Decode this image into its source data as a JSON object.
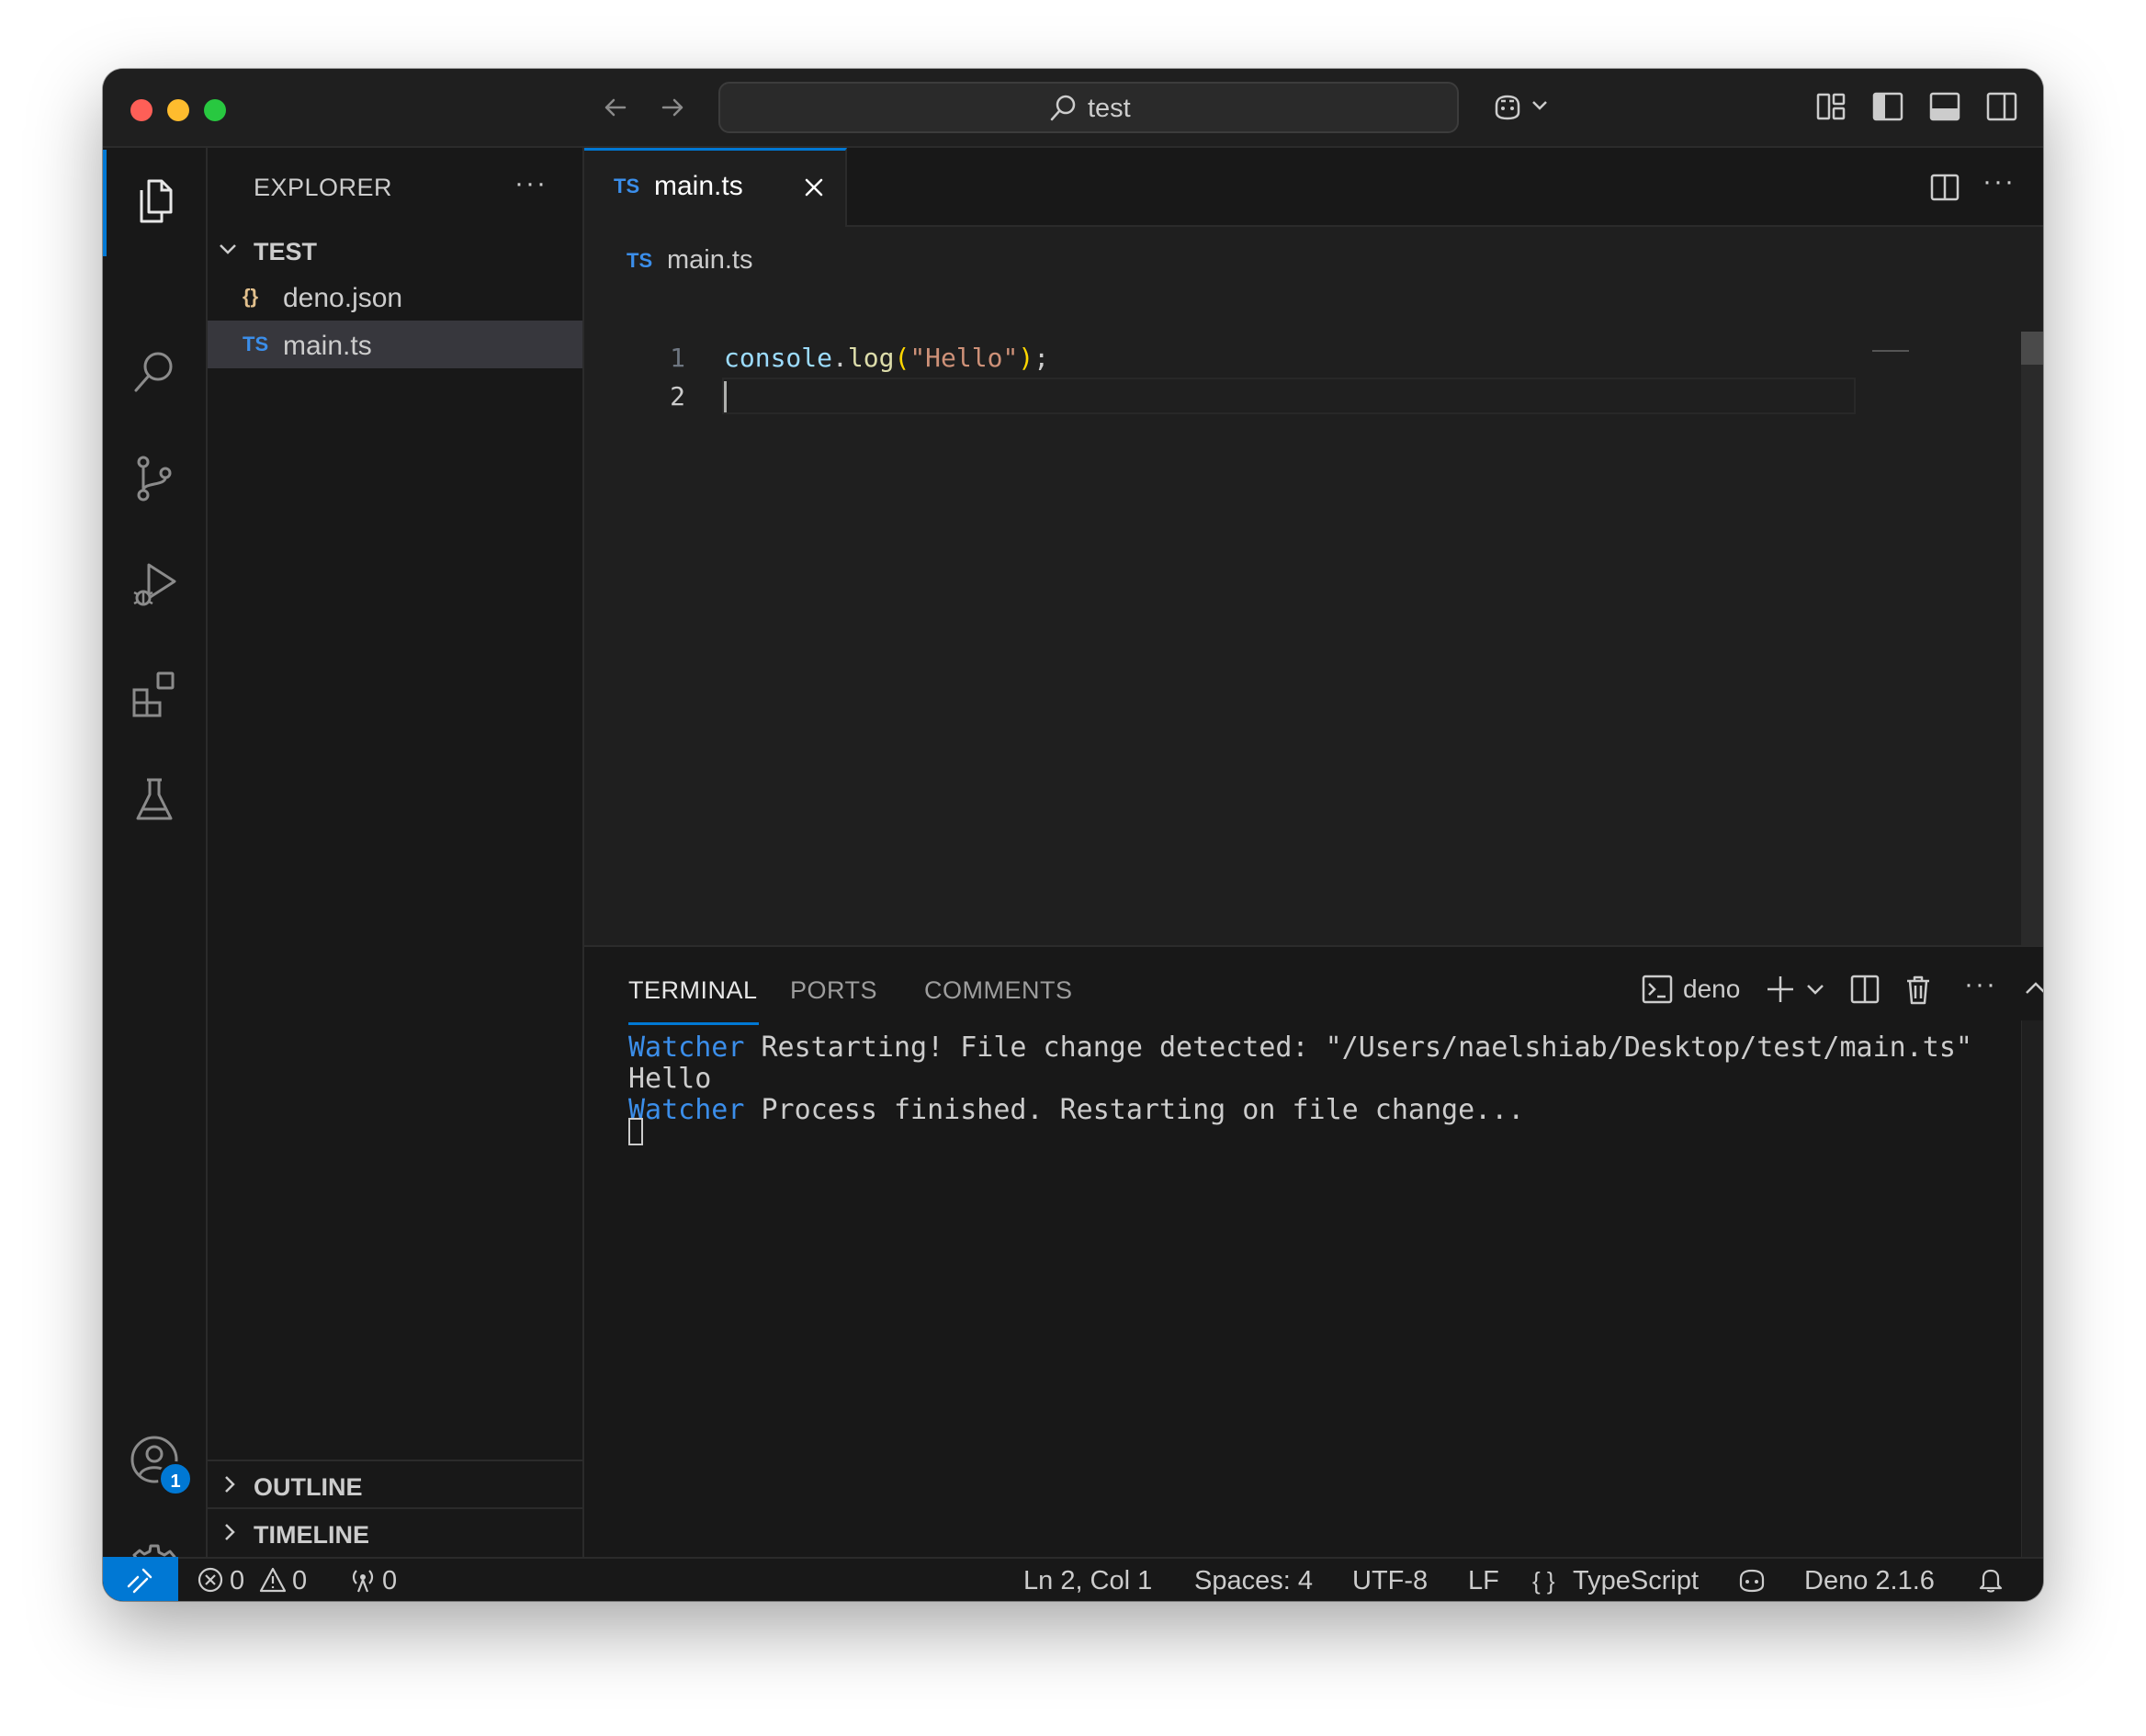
{
  "titlebar": {
    "search_text": "test"
  },
  "sidebar": {
    "title": "EXPLORER",
    "more": "···",
    "folder": "TEST",
    "files": [
      {
        "icon": "{}",
        "name": "deno.json"
      },
      {
        "icon": "TS",
        "name": "main.ts"
      }
    ],
    "sections": [
      "OUTLINE",
      "TIMELINE"
    ]
  },
  "activity": {
    "account_badge": "1"
  },
  "editor": {
    "tab": {
      "lang": "TS",
      "name": "main.ts"
    },
    "breadcrumb": {
      "lang": "TS",
      "name": "main.ts"
    },
    "lines": [
      {
        "number": "1",
        "text": "console.log(\"Hello\");"
      },
      {
        "number": "2",
        "text": ""
      }
    ],
    "more": "···"
  },
  "panel": {
    "tabs": [
      "TERMINAL",
      "PORTS",
      "COMMENTS"
    ],
    "terminal_name": "deno",
    "more": "···",
    "output": [
      {
        "prefix": "Watcher",
        "text": " Restarting! File change detected: \"/Users/naelshiab/Desktop/test/main.ts\""
      },
      {
        "prefix": "",
        "text": "Hello"
      },
      {
        "prefix": "Watcher",
        "text": " Process finished. Restarting on file change..."
      }
    ]
  },
  "statusbar": {
    "errors": "0",
    "warnings": "0",
    "ports": "0",
    "position": "Ln 2, Col 1",
    "spaces": "Spaces: 4",
    "encoding": "UTF-8",
    "eol": "LF",
    "language_icon": "{ }",
    "language": "TypeScript",
    "deno_version": "Deno 2.1.6"
  },
  "colors": {
    "accent": "#0078d4",
    "ts_icon": "#3b8eea",
    "json_icon": "#e2c08d",
    "watcher": "#3b8eea",
    "identifier": "#9cdcfe",
    "function": "#dcdcaa",
    "string": "#ce9178",
    "bracket": "#ffd700"
  }
}
